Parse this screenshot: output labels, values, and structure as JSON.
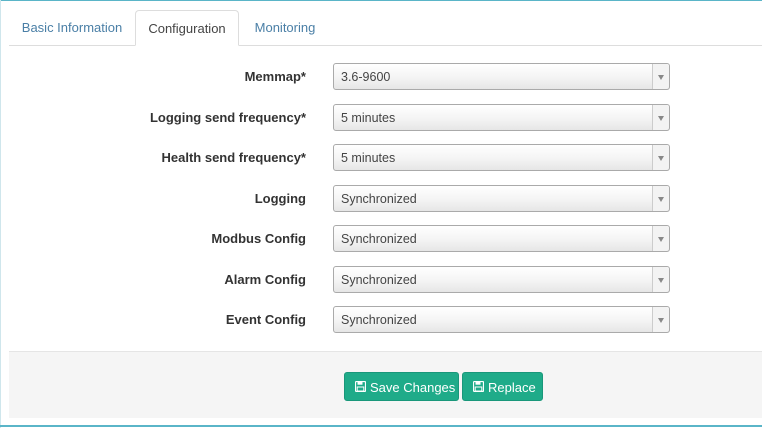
{
  "tabs": [
    {
      "label": "Basic Information"
    },
    {
      "label": "Configuration"
    },
    {
      "label": "Monitoring"
    }
  ],
  "form": {
    "fields": [
      {
        "label": "Memmap*",
        "value": "3.6-9600"
      },
      {
        "label": "Logging send frequency*",
        "value": "5 minutes"
      },
      {
        "label": "Health send frequency*",
        "value": "5 minutes"
      },
      {
        "label": "Logging",
        "value": "Synchronized"
      },
      {
        "label": "Modbus Config",
        "value": "Synchronized"
      },
      {
        "label": "Alarm Config",
        "value": "Synchronized"
      },
      {
        "label": "Event Config",
        "value": "Synchronized"
      }
    ]
  },
  "footer": {
    "save_label": "Save Changes",
    "replace_label": "Replace",
    "save_icon": "floppy-disk-icon",
    "replace_icon": "floppy-disk-icon"
  },
  "colors": {
    "accent": "#1fab89",
    "tab_link": "#4a7fa6",
    "border_top": "#5ab5c8"
  }
}
